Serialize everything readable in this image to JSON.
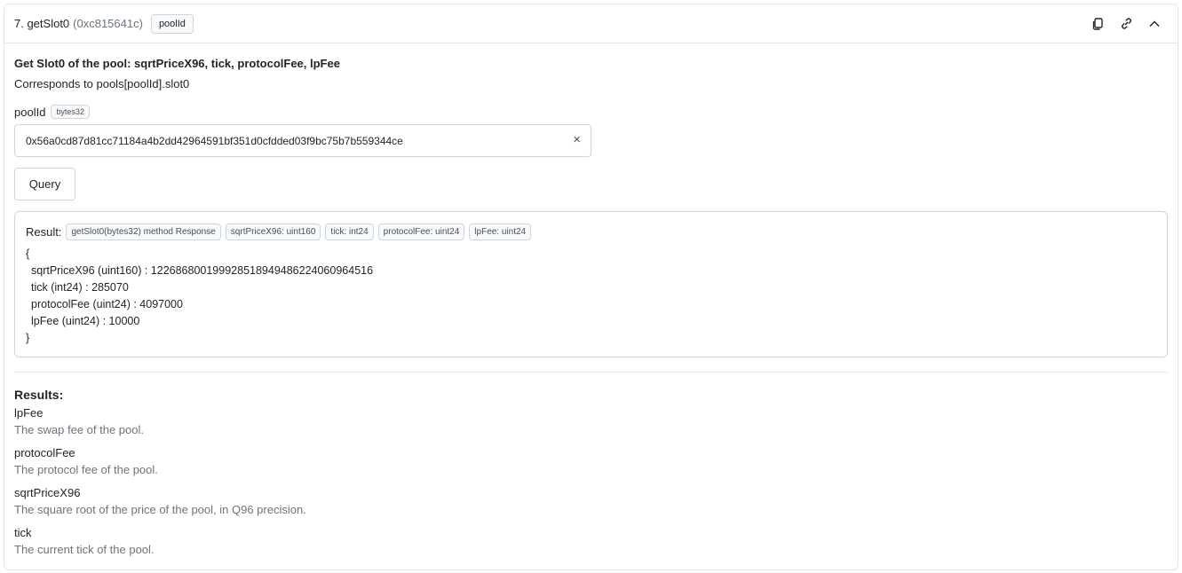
{
  "header": {
    "title": "7. getSlot0",
    "address": "(0xc815641c)",
    "tag": "poolId",
    "icons": [
      "copy-icon",
      "link-icon",
      "chevron-up-icon"
    ]
  },
  "description": {
    "title": "Get Slot0 of the pool: sqrtPriceX96, tick, protocolFee, lpFee",
    "subtitle": "Corresponds to pools[poolId].slot0"
  },
  "param": {
    "name": "poolId",
    "type": "bytes32",
    "value": "0x56a0cd87d81cc71184a4b2dd42964591bf351d0cfdded03f9bc75b7b559344ce",
    "clear": "×"
  },
  "query_button": "Query",
  "result": {
    "label": "Result:",
    "chips": [
      "getSlot0(bytes32) method Response",
      "sqrtPriceX96: uint160",
      "tick: int24",
      "protocolFee: uint24",
      "lpFee: uint24"
    ],
    "open_brace": "{",
    "lines": [
      "sqrtPriceX96 (uint160) : 122686800199928518949486224060964516",
      "tick (int24) : 285070",
      "protocolFee (uint24) : 4097000",
      "lpFee (uint24) : 10000"
    ],
    "close_brace": "}"
  },
  "results_section": {
    "title": "Results:",
    "items": [
      {
        "name": "lpFee",
        "desc": "The swap fee of the pool."
      },
      {
        "name": "protocolFee",
        "desc": "The protocol fee of the pool."
      },
      {
        "name": "sqrtPriceX96",
        "desc": "The square root of the price of the pool, in Q96 precision."
      },
      {
        "name": "tick",
        "desc": "The current tick of the pool."
      }
    ]
  }
}
